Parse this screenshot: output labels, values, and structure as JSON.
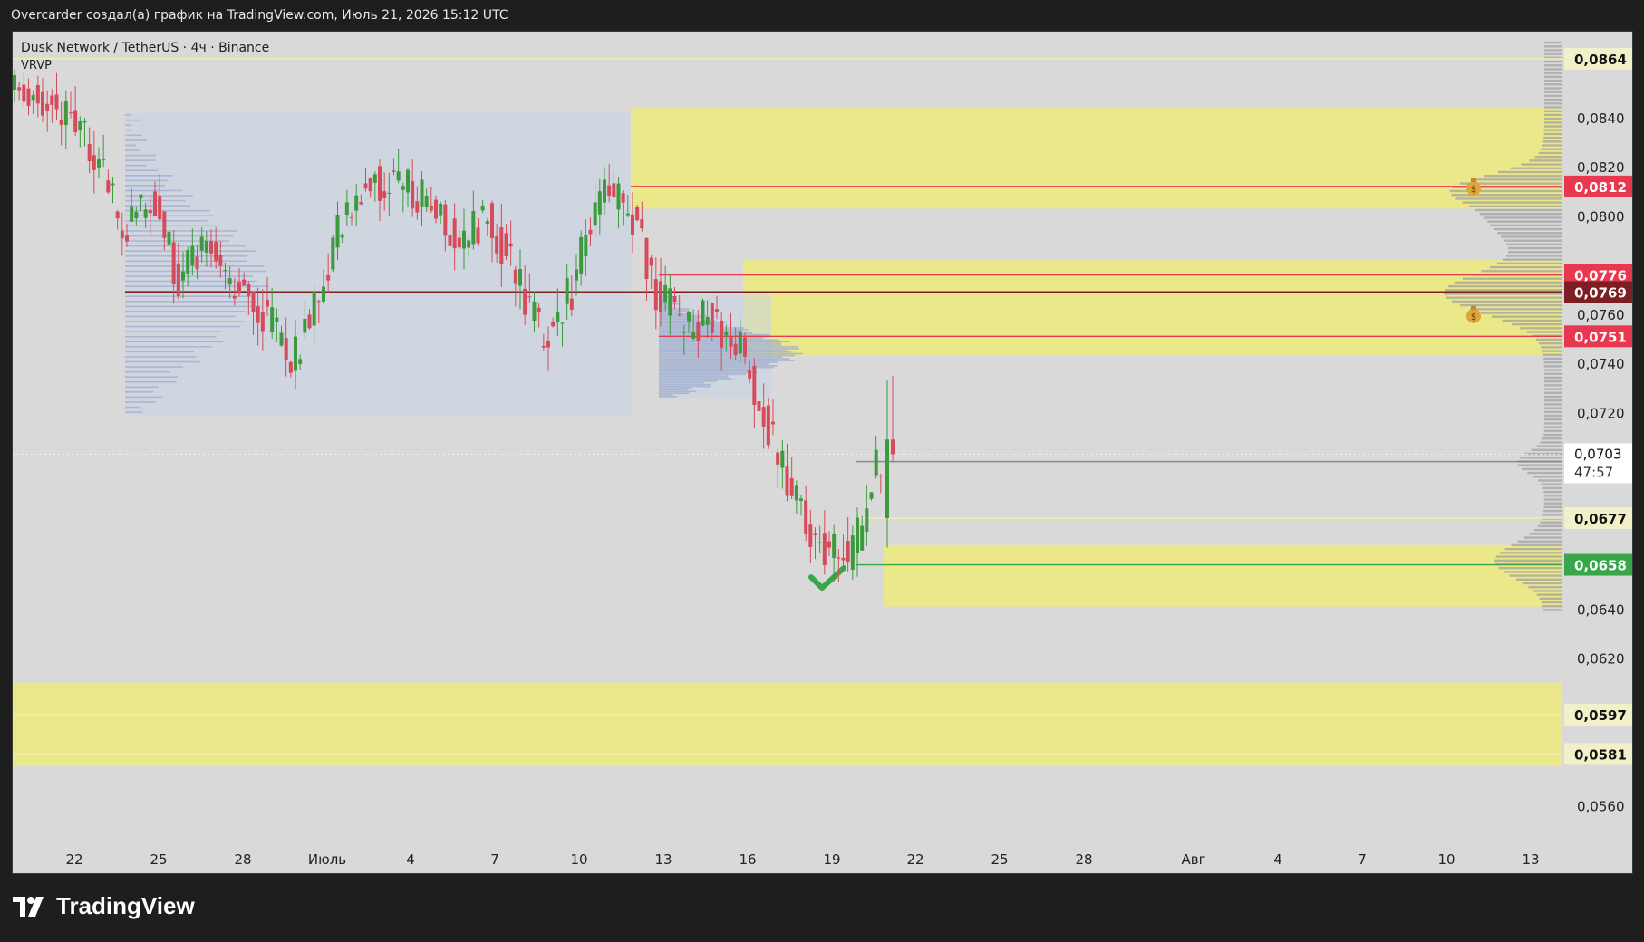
{
  "caption": "Overcarder создал(а) график на TradingView.com, Июль 21, 2026 15:12 UTC",
  "symbol": "Dusk Network / TetherUS · 4ч · Binance",
  "indicator": "VRVP",
  "brand": "TradingView",
  "icons": {
    "brand_logo": "tradingview-logo-icon",
    "money_bag": "money-bag-icon",
    "check": "check-mark-icon"
  },
  "colors": {
    "panel_bg": "#d9d9d9",
    "zone": "#ebe88a",
    "candle_up": "#3c9a3c",
    "candle_down": "#d64a5a",
    "volume_profile": "#9aa8cc",
    "resistance": "#e8384f",
    "poc": "#7d1e25",
    "support_green": "#3aa64a",
    "yellow_line": "#f4f0a6"
  },
  "chart_data": {
    "type": "candlestick",
    "y_axis": {
      "min": 0.0545,
      "max": 0.0875,
      "ticks": [
        "0,0560",
        "0,0620",
        "0,0640",
        "0,0720",
        "0,0740",
        "0,0760",
        "0,0800",
        "0,0820",
        "0,0840"
      ]
    },
    "x_axis": {
      "labels": [
        "22",
        "25",
        "28",
        "Июль",
        "4",
        "7",
        "10",
        "13",
        "16",
        "19",
        "22",
        "25",
        "28",
        "Авг",
        "4",
        "7",
        "10",
        "13"
      ]
    },
    "price_levels": [
      {
        "label": "0,0864",
        "value": 0.0864,
        "color": "#f4f0a6",
        "style": "yellow"
      },
      {
        "label": "0,0812",
        "value": 0.0812,
        "color": "#e8384f",
        "style": "red"
      },
      {
        "label": "0,0776",
        "value": 0.0776,
        "color": "#e8384f",
        "style": "red"
      },
      {
        "label": "0,0769",
        "value": 0.0769,
        "color": "#7d1e25",
        "style": "poc"
      },
      {
        "label": "0,0751",
        "value": 0.0751,
        "color": "#e8384f",
        "style": "red"
      },
      {
        "label": "0,0700",
        "value": 0.07,
        "color": "#8a8a8a",
        "style": "gray"
      },
      {
        "label": "0,0677",
        "value": 0.0677,
        "color": "#f4f0a6",
        "style": "yellow"
      },
      {
        "label": "0,0658",
        "value": 0.0658,
        "color": "#3aa64a",
        "style": "green"
      },
      {
        "label": "0,0597",
        "value": 0.0597,
        "color": "#f4f0a6",
        "style": "yellow"
      },
      {
        "label": "0,0581",
        "value": 0.0581,
        "color": "#f4f0a6",
        "style": "yellow"
      }
    ],
    "current_price": {
      "value": 0.0703,
      "label": "0,0703",
      "countdown": "47:57"
    },
    "zones": [
      {
        "top": 0.0844,
        "bottom": 0.0803,
        "from": "2026-07-12",
        "to": "right-edge"
      },
      {
        "top": 0.0782,
        "bottom": 0.0743,
        "from": "2026-07-16",
        "to": "right-edge"
      },
      {
        "top": 0.0666,
        "bottom": 0.0641,
        "from": "2026-07-21",
        "to": "right-edge"
      },
      {
        "top": 0.061,
        "bottom": 0.0576,
        "from": "left-edge",
        "to": "right-edge"
      }
    ],
    "annotations": [
      {
        "type": "money-bag",
        "date": "2026-08-11",
        "value": 0.0812
      },
      {
        "type": "money-bag",
        "date": "2026-08-11",
        "value": 0.076
      },
      {
        "type": "check",
        "date": "2026-07-19",
        "value": 0.0653
      }
    ],
    "candles_summary": [
      {
        "date": "2026-06-20",
        "value": 0.0855
      },
      {
        "date": "2026-06-22",
        "value": 0.084
      },
      {
        "date": "2026-06-23",
        "value": 0.0825
      },
      {
        "date": "2026-06-24",
        "value": 0.0795
      },
      {
        "date": "2026-06-25",
        "value": 0.081
      },
      {
        "date": "2026-06-26",
        "value": 0.0775
      },
      {
        "date": "2026-06-27",
        "value": 0.079
      },
      {
        "date": "2026-06-28",
        "value": 0.077
      },
      {
        "date": "2026-06-29",
        "value": 0.0762
      },
      {
        "date": "2026-06-30",
        "value": 0.074
      },
      {
        "date": "2026-07-01",
        "value": 0.077
      },
      {
        "date": "2026-07-02",
        "value": 0.0805
      },
      {
        "date": "2026-07-03",
        "value": 0.0815
      },
      {
        "date": "2026-07-04",
        "value": 0.0812
      },
      {
        "date": "2026-07-05",
        "value": 0.0805
      },
      {
        "date": "2026-07-06",
        "value": 0.079
      },
      {
        "date": "2026-07-07",
        "value": 0.08
      },
      {
        "date": "2026-07-08",
        "value": 0.0775
      },
      {
        "date": "2026-07-09",
        "value": 0.0748
      },
      {
        "date": "2026-07-10",
        "value": 0.077
      },
      {
        "date": "2026-07-11",
        "value": 0.081
      },
      {
        "date": "2026-07-12",
        "value": 0.0805
      },
      {
        "date": "2026-07-13",
        "value": 0.077
      },
      {
        "date": "2026-07-14",
        "value": 0.0755
      },
      {
        "date": "2026-07-15",
        "value": 0.076
      },
      {
        "date": "2026-07-16",
        "value": 0.0745
      },
      {
        "date": "2026-07-17",
        "value": 0.0712
      },
      {
        "date": "2026-07-18",
        "value": 0.0682
      },
      {
        "date": "2026-07-19",
        "value": 0.0662
      },
      {
        "date": "2026-07-20",
        "value": 0.0662
      },
      {
        "date": "2026-07-21",
        "value": 0.0703
      }
    ]
  }
}
